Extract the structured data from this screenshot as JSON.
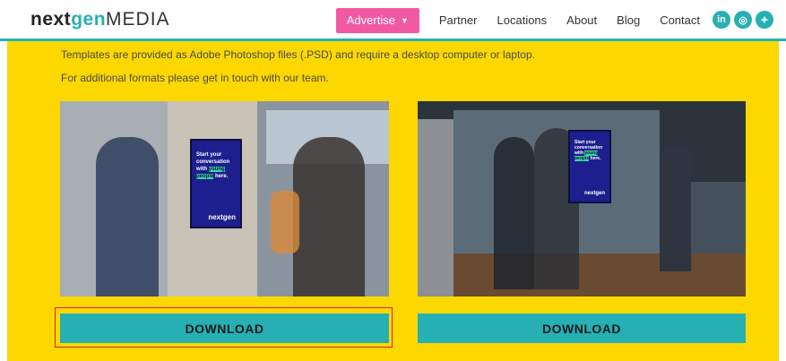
{
  "logo": {
    "part1": "next",
    "part2": "gen",
    "part3": "MEDIA"
  },
  "nav": {
    "items": [
      {
        "label": "Advertise"
      },
      {
        "label": "Partner"
      },
      {
        "label": "Locations"
      },
      {
        "label": "About"
      },
      {
        "label": "Blog"
      },
      {
        "label": "Contact"
      }
    ]
  },
  "social": [
    {
      "icon": "linkedin-icon",
      "glyph": "in"
    },
    {
      "icon": "instagram-icon",
      "glyph": "◎"
    },
    {
      "icon": "twitter-icon",
      "glyph": "✦"
    }
  ],
  "content": {
    "line1": "Templates are provided as Adobe Photoshop files (.PSD) and require a desktop computer or laptop.",
    "line2": "For additional formats please get in touch with our team."
  },
  "screens": {
    "text_before": "Start your conversation with",
    "text_highlight": "young people",
    "text_after": "here.",
    "logo": "nextgen"
  },
  "downloads": [
    {
      "label": "DOWNLOAD"
    },
    {
      "label": "DOWNLOAD"
    }
  ],
  "colors": {
    "accent": "#27b0b3",
    "brand_pink": "#ef5aa3",
    "background": "#fcd800",
    "focus_outline": "#e21b1b"
  }
}
